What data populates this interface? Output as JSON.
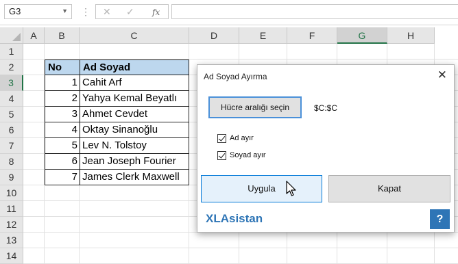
{
  "formula_bar": {
    "name_box": "G3",
    "separator_glyph": "⋮",
    "cancel_glyph": "✕",
    "enter_glyph": "✓",
    "function_glyph": "fx",
    "formula": ""
  },
  "sheet": {
    "columns": [
      "A",
      "B",
      "C",
      "D",
      "E",
      "F",
      "G",
      "H"
    ],
    "rows": [
      "1",
      "2",
      "3",
      "4",
      "5",
      "6",
      "7",
      "8",
      "9",
      "10",
      "11",
      "12",
      "13",
      "14"
    ],
    "selected_column": "G",
    "selected_row": "3",
    "table_header": {
      "no": "No",
      "name": "Ad Soyad"
    },
    "table_rows": [
      {
        "no": "1",
        "name": "Cahit Arf"
      },
      {
        "no": "2",
        "name": "Yahya Kemal Beyatlı"
      },
      {
        "no": "3",
        "name": "Ahmet Cevdet"
      },
      {
        "no": "4",
        "name": "Oktay Sinanoğlu"
      },
      {
        "no": "5",
        "name": "Lev N. Tolstoy"
      },
      {
        "no": "6",
        "name": "Jean Joseph Fourier"
      },
      {
        "no": "7",
        "name": "James Clerk Maxwell"
      }
    ],
    "header_fill": "#bdd7ee",
    "selection_accent": "#217346"
  },
  "dialog": {
    "title": "Ad Soyad Ayırma",
    "close_glyph": "✕",
    "range_button": "Hücre aralığı seçin",
    "range_value": "$C:$C",
    "option_first_name": "Ad ayır",
    "option_first_name_checked": true,
    "option_last_name": "Soyad ayır",
    "option_last_name_checked": true,
    "apply_button": "Uygula",
    "close_button": "Kapat",
    "brand": "XLAsistan",
    "help_glyph": "?",
    "brand_color": "#2e75b6"
  }
}
